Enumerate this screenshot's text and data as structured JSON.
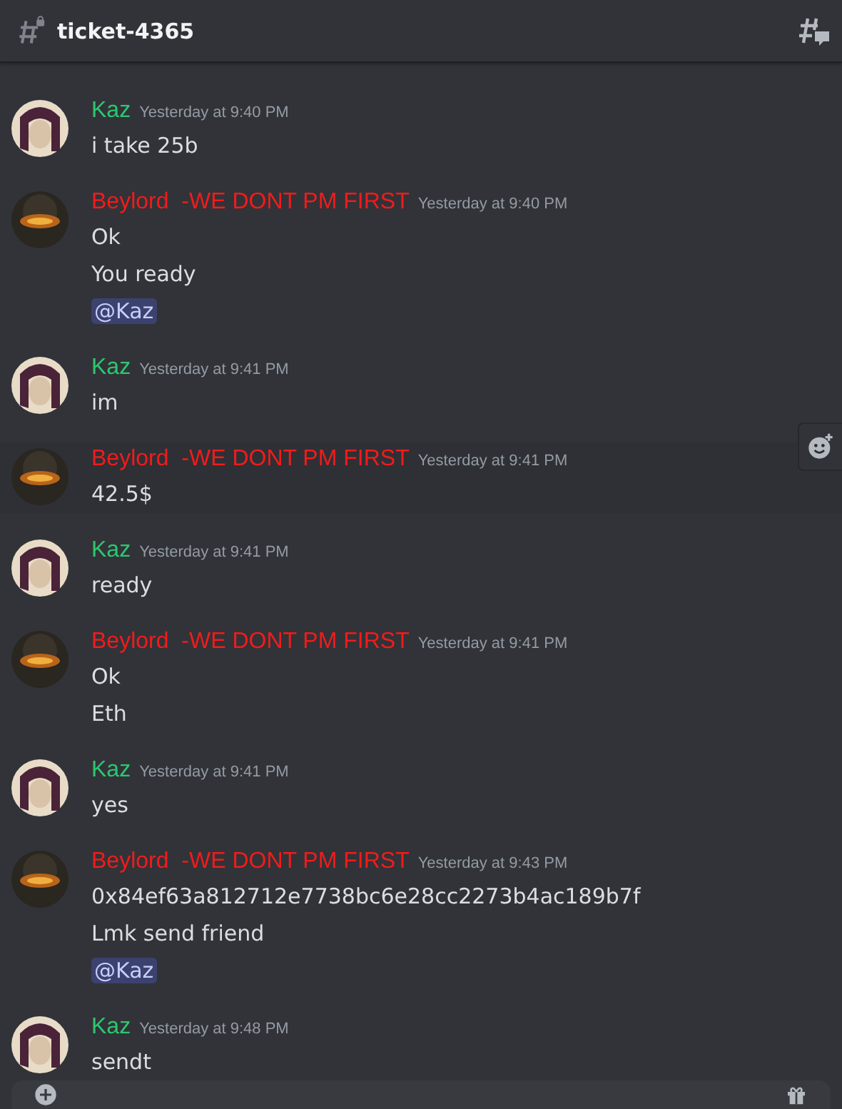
{
  "channel": {
    "title": "ticket-4365"
  },
  "messages": [
    {
      "author": "Kaz",
      "kind": "portrait",
      "color": "#2dc770",
      "time": "Yesterday at 9:40 PM",
      "hovered": false,
      "lines": [
        {
          "kind": "text",
          "text": "i take 25b"
        }
      ]
    },
    {
      "author": "Beylord  -WE DONT PM FIRST",
      "kind": "emblem",
      "color": "#f21b1b",
      "time": "Yesterday at 9:40 PM",
      "hovered": false,
      "lines": [
        {
          "kind": "text",
          "text": "Ok"
        },
        {
          "kind": "text",
          "text": "You ready"
        },
        {
          "kind": "mention",
          "text": "@Kaz"
        }
      ]
    },
    {
      "author": "Kaz",
      "kind": "portrait",
      "color": "#2dc770",
      "time": "Yesterday at 9:41 PM",
      "hovered": false,
      "lines": [
        {
          "kind": "text",
          "text": "im"
        }
      ]
    },
    {
      "author": "Beylord  -WE DONT PM FIRST",
      "kind": "emblem",
      "color": "#f21b1b",
      "time": "Yesterday at 9:41 PM",
      "hovered": true,
      "lines": [
        {
          "kind": "text",
          "text": "42.5$"
        }
      ]
    },
    {
      "author": "Kaz",
      "kind": "portrait",
      "color": "#2dc770",
      "time": "Yesterday at 9:41 PM",
      "hovered": false,
      "lines": [
        {
          "kind": "text",
          "text": "ready"
        }
      ]
    },
    {
      "author": "Beylord  -WE DONT PM FIRST",
      "kind": "emblem",
      "color": "#f21b1b",
      "time": "Yesterday at 9:41 PM",
      "hovered": false,
      "lines": [
        {
          "kind": "text",
          "text": "Ok"
        },
        {
          "kind": "text",
          "text": "Eth"
        }
      ]
    },
    {
      "author": "Kaz",
      "kind": "portrait",
      "color": "#2dc770",
      "time": "Yesterday at 9:41 PM",
      "hovered": false,
      "lines": [
        {
          "kind": "text",
          "text": "yes"
        }
      ]
    },
    {
      "author": "Beylord  -WE DONT PM FIRST",
      "kind": "emblem",
      "color": "#f21b1b",
      "time": "Yesterday at 9:43 PM",
      "hovered": false,
      "lines": [
        {
          "kind": "text",
          "text": "0x84ef63a812712e7738bc6e28cc2273b4ac189b7f"
        },
        {
          "kind": "text",
          "text": "Lmk send friend"
        },
        {
          "kind": "mention",
          "text": "@Kaz"
        }
      ]
    },
    {
      "author": "Kaz",
      "kind": "portrait",
      "color": "#2dc770",
      "time": "Yesterday at 9:48 PM",
      "hovered": false,
      "lines": [
        {
          "kind": "text",
          "text": "sendt"
        }
      ]
    }
  ]
}
